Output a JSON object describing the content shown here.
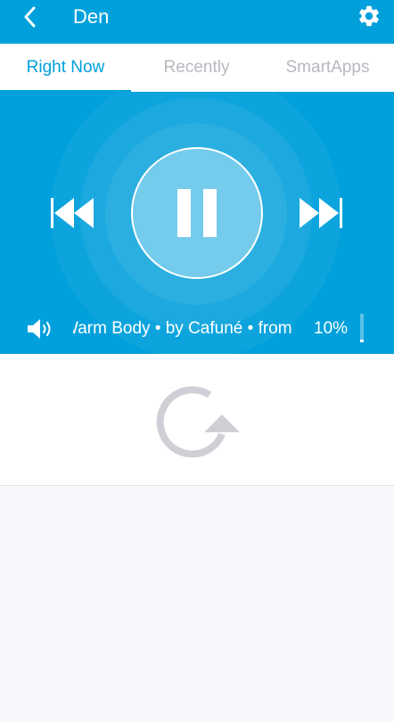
{
  "header": {
    "title": "Den",
    "back_icon": "chevron-left-icon",
    "settings_icon": "gear-icon"
  },
  "tabs": [
    {
      "label": "Right Now",
      "active": true
    },
    {
      "label": "Recently",
      "active": false
    },
    {
      "label": "SmartApps",
      "active": false
    }
  ],
  "player": {
    "state": "playing",
    "track_text": "Warm Body • by Cafuné • from",
    "volume_percent_label": "10%",
    "volume_level": 0.1
  },
  "loading": {
    "icon": "refresh-icon"
  },
  "colors": {
    "accent": "#00a0dc",
    "tab_inactive": "#b7b9c0",
    "refresh_icon": "#cfd0d5",
    "background": "#f7f8fc"
  }
}
